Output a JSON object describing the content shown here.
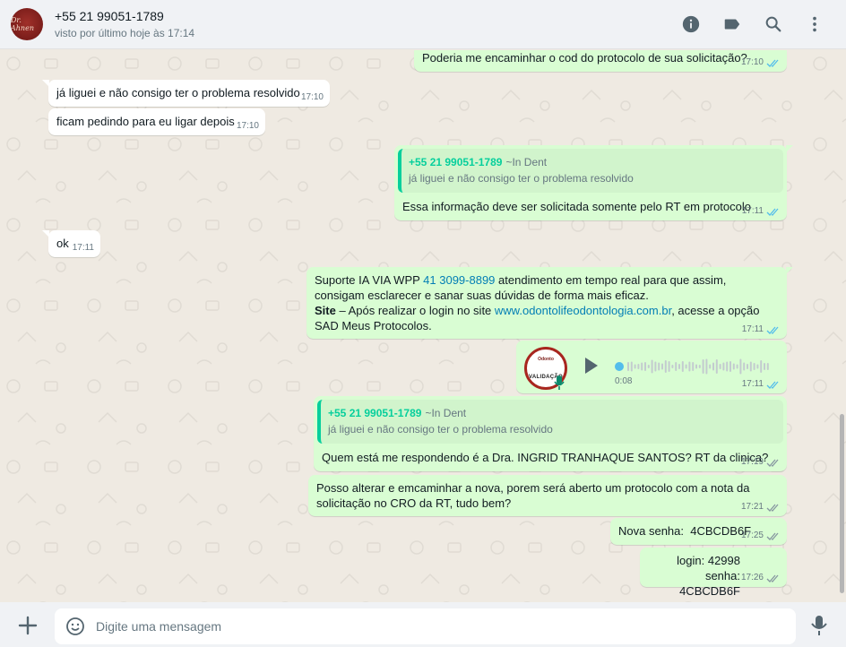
{
  "header": {
    "avatar_text": "Dr. Ahnen",
    "contact_name": "+55 21 99051-1789",
    "status": "visto por último hoje às 17:14"
  },
  "icons": {
    "info": "info-icon",
    "label": "label-icon",
    "search": "search-icon",
    "menu": "menu-icon"
  },
  "colors": {
    "outgoing_bubble": "#d9fdd3",
    "incoming_bubble": "#ffffff",
    "accent": "#06cf9c",
    "read_ticks": "#53bdeb"
  },
  "messages": [
    {
      "text": "Poderia me encaminhar o cod do protocolo de sua solicitação?",
      "time": "17:10",
      "ticks": "read"
    },
    {
      "text": "já liguei e não consigo ter o problema resolvido",
      "time": "17:10"
    },
    {
      "text": "ficam pedindo para eu ligar depois",
      "time": "17:10"
    },
    {
      "quote_name": "+55 21 99051-1789",
      "quote_sub": "~In Dent",
      "quote_text": "já liguei e não consigo ter o problema resolvido",
      "text": "Essa informação deve ser solicitada somente pelo RT em protocolo",
      "time": "17:11",
      "ticks": "read"
    },
    {
      "text": "ok",
      "time": "17:11"
    },
    {
      "text_a": "Suporte IA VIA WPP ",
      "link_phone": "41 3099-8899",
      "text_b": " atendimento em tempo real para que assim, consigam esclarecer e sanar suas dúvidas de forma mais eficaz.",
      "bold": "Site",
      "text_c": " – Após realizar o login no site ",
      "link_site": "www.odontolifeodontologia.com.br",
      "text_d": ", acesse a opção SAD Meus Protocolos.",
      "time": "17:11",
      "ticks": "read"
    },
    {
      "audio_label_1": "Odonto",
      "audio_label_2": "VALIDAÇÃO",
      "duration": "0:08",
      "time": "17:11",
      "ticks": "read"
    },
    {
      "quote_name": "+55 21 99051-1789",
      "quote_sub": "~In Dent",
      "quote_text": "já liguei e não consigo ter o problema resolvido",
      "text": "Quem está me respondendo é a Dra. INGRID TRANHAQUE SANTOS? RT da clinica?",
      "time": "17:19",
      "ticks": "sent"
    },
    {
      "text": "Posso alterar e emcaminhar a nova, porem será aberto um protocolo com a nota da solicitação no CRO da RT, tudo bem?",
      "time": "17:21",
      "ticks": "sent"
    },
    {
      "text": "Nova senha:  4CBCDB6F",
      "time": "17:25",
      "ticks": "sent"
    },
    {
      "text_1": "login: 42998",
      "text_2": "senha: 4CBCDB6F",
      "time": "17:26",
      "ticks": "sent"
    }
  ],
  "composer": {
    "placeholder": "Digite uma mensagem"
  }
}
